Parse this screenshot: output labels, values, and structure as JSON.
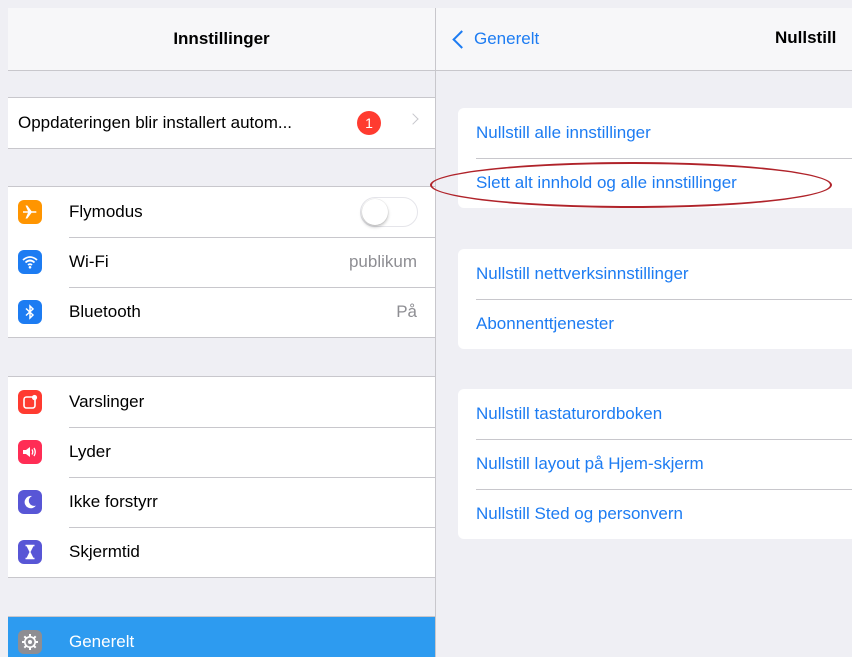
{
  "left_pane": {
    "title": "Innstillinger",
    "update_row": {
      "label": "Oppdateringen blir installert autom...",
      "badge": "1"
    },
    "connectivity": [
      {
        "label": "Flymodus",
        "icon": "airplane-icon",
        "color": "#ff9500",
        "value": "",
        "toggle_on": false
      },
      {
        "label": "Wi-Fi",
        "icon": "wifi-icon",
        "color": "#1d7cf2",
        "value": "publikum"
      },
      {
        "label": "Bluetooth",
        "icon": "bluetooth-icon",
        "color": "#1d7cf2",
        "value": "På"
      }
    ],
    "notifications": [
      {
        "label": "Varslinger",
        "icon": "notifications-icon",
        "color": "#ff3b30"
      },
      {
        "label": "Lyder",
        "icon": "sounds-icon",
        "color": "#ff2d55"
      },
      {
        "label": "Ikke forstyrr",
        "icon": "moon-icon",
        "color": "#5856d6"
      },
      {
        "label": "Skjermtid",
        "icon": "hourglass-icon",
        "color": "#5856d6"
      }
    ],
    "general": {
      "label": "Generelt",
      "icon": "gear-icon",
      "color": "#8e8e93",
      "selected": true
    }
  },
  "right_pane": {
    "back_label": "Generelt",
    "title": "Nullstill",
    "groups": [
      [
        "Nullstill alle innstillinger",
        "Slett alt innhold og alle innstillinger"
      ],
      [
        "Nullstill nettverksinnstillinger",
        "Abonnenttjenester"
      ],
      [
        "Nullstill tastaturordboken",
        "Nullstill layout på Hjem-skjerm",
        "Nullstill Sted og personvern"
      ]
    ]
  },
  "colors": {
    "accent": "#1d7cf2",
    "selected_row": "#2d9bf0",
    "badge": "#ff3b30",
    "annotation_ellipse": "#b0232a"
  }
}
